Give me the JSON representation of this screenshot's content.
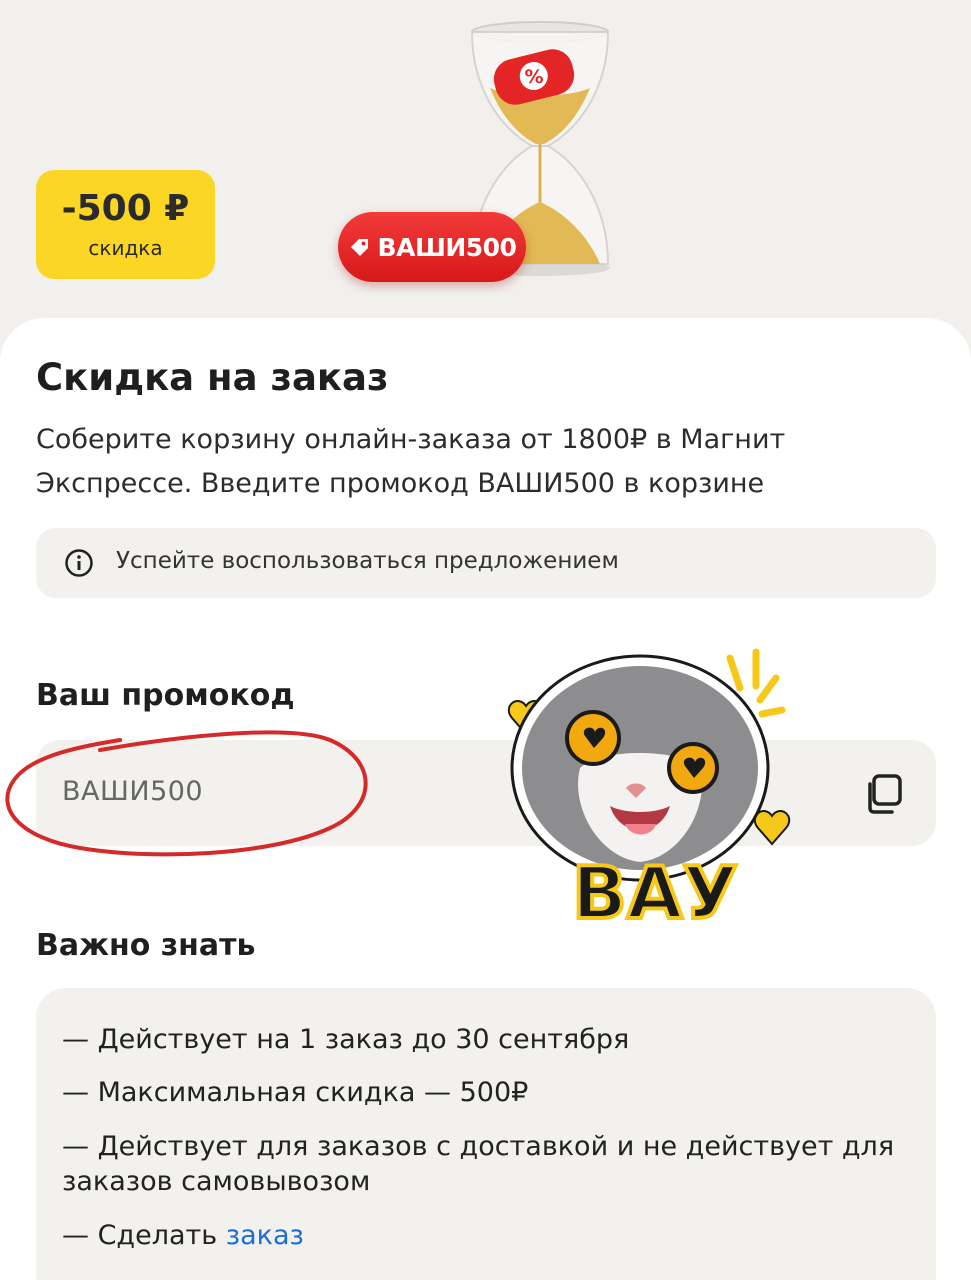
{
  "hero": {
    "discount_amount": "-500 ₽",
    "discount_caption": "скидка",
    "promo_tag": "ВАШИ500",
    "hourglass_badge": "%"
  },
  "card": {
    "title": "Скидка на заказ",
    "description": "Соберите корзину онлайн-заказа от 1800₽ в Магнит Экспрессе. Введите промокод ВАШИ500 в корзине",
    "info_text": "Успейте воспользоваться предложением",
    "promo_label": "Ваш промокод",
    "promo_code": "ВАШИ500",
    "sticker_text": "ВАУ",
    "important_title": "Важно знать",
    "rules": [
      "— Действует на 1 заказ до 30 сентября",
      "— Максимальная скидка — 500₽",
      "— Действует для заказов с доставкой и не действует для заказов самовывозом"
    ],
    "last_rule_prefix": "— Сделать ",
    "last_rule_link": "заказ"
  },
  "colors": {
    "badge_yellow": "#fcd624",
    "promo_red": "#e42525",
    "link_blue": "#1c6fd0",
    "annotation_red": "#d42a2a"
  },
  "icons": [
    "percent-icon",
    "tag-icon",
    "info-icon",
    "copy-icon",
    "heart-icon"
  ]
}
